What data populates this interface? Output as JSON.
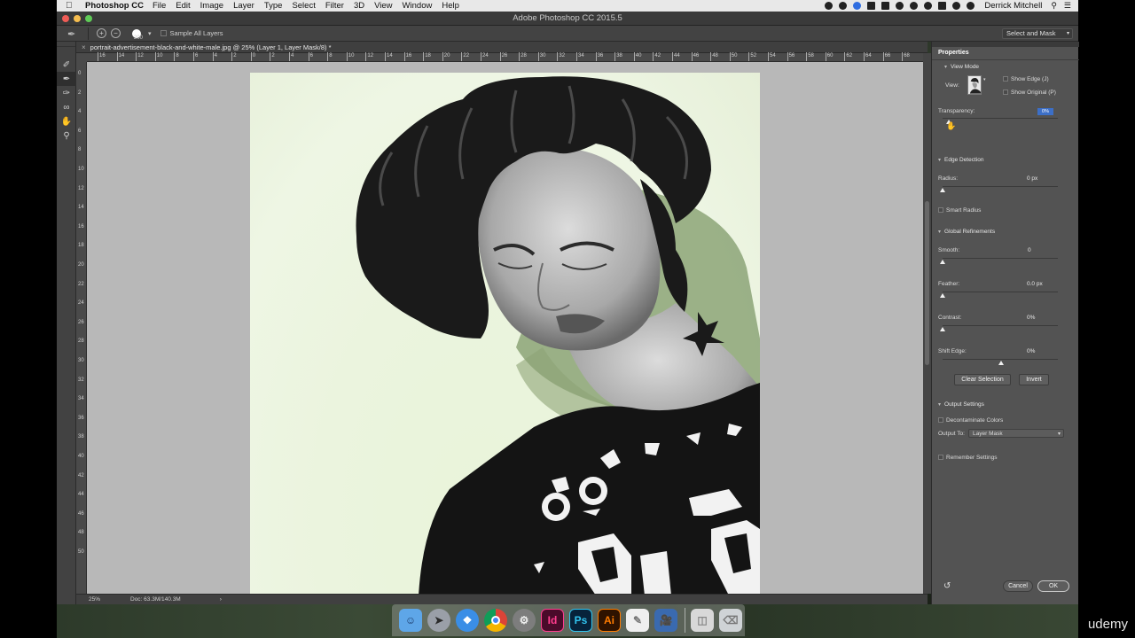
{
  "menubar": {
    "app_name": "Photoshop CC",
    "items": [
      "File",
      "Edit",
      "Image",
      "Layer",
      "Type",
      "Select",
      "Filter",
      "3D",
      "View",
      "Window",
      "Help"
    ],
    "user_name": "Derrick Mitchell"
  },
  "window": {
    "title": "Adobe Photoshop CC 2015.5"
  },
  "options_bar": {
    "brush_size": "200",
    "sample_all_layers_label": "Sample All Layers",
    "workspace_label": "Select and Mask"
  },
  "document": {
    "tab_title": "portrait-advertisement-black-and-white-male.jpg @ 25% (Layer 1, Layer Mask/8) *",
    "zoom": "25%",
    "doc_size": "Doc: 63.3M/140.3M",
    "ruler_h_ticks": [
      "16",
      "14",
      "12",
      "10",
      "8",
      "6",
      "4",
      "2",
      "0",
      "2",
      "4",
      "6",
      "8",
      "10",
      "12",
      "14",
      "16",
      "18",
      "20",
      "22",
      "24",
      "26",
      "28",
      "30",
      "32",
      "34",
      "36",
      "38",
      "40",
      "42",
      "44",
      "46",
      "48",
      "50",
      "52",
      "54",
      "56",
      "58",
      "60",
      "62",
      "64",
      "66",
      "68"
    ],
    "ruler_v_ticks": [
      "0",
      "2",
      "4",
      "6",
      "8",
      "10",
      "12",
      "14",
      "16",
      "18",
      "20",
      "22",
      "24",
      "26",
      "28",
      "30",
      "32",
      "34",
      "36",
      "38",
      "40",
      "42",
      "44",
      "46",
      "48",
      "50"
    ]
  },
  "properties": {
    "title": "Properties",
    "view_mode": {
      "heading": "View Mode",
      "view_label": "View:",
      "show_edge_label": "Show Edge (J)",
      "show_original_label": "Show Original (P)",
      "transparency_label": "Transparency:",
      "transparency_value": "0%"
    },
    "edge_detection": {
      "heading": "Edge Detection",
      "radius_label": "Radius:",
      "radius_value": "0 px",
      "smart_radius_label": "Smart Radius"
    },
    "global_refinements": {
      "heading": "Global Refinements",
      "smooth_label": "Smooth:",
      "smooth_value": "0",
      "feather_label": "Feather:",
      "feather_value": "0.0 px",
      "contrast_label": "Contrast:",
      "contrast_value": "0%",
      "shift_edge_label": "Shift Edge:",
      "shift_edge_value": "0%",
      "clear_selection_label": "Clear Selection",
      "invert_label": "Invert"
    },
    "output_settings": {
      "heading": "Output Settings",
      "decontaminate_label": "Decontaminate Colors",
      "output_to_label": "Output To:",
      "output_to_value": "Layer Mask",
      "remember_label": "Remember Settings"
    },
    "cancel_label": "Cancel",
    "ok_label": "OK"
  },
  "dock": {
    "indesign_label": "Id",
    "photoshop_label": "Ps",
    "illustrator_label": "Ai"
  },
  "watermark": "udemy"
}
